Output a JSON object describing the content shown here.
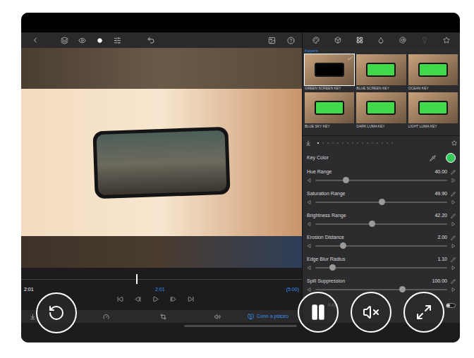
{
  "panel": {
    "section": "Keyers",
    "keyers": [
      {
        "label": "GREEN SCREEN KEY",
        "selected": true
      },
      {
        "label": "BLUE SCREEN KEY",
        "selected": false
      },
      {
        "label": "OCEAN KEY",
        "selected": false
      },
      {
        "label": "BLUE SKY KEY",
        "selected": false
      },
      {
        "label": "DARK LUMA KEY",
        "selected": false
      },
      {
        "label": "LIGHT LUMA KEY",
        "selected": false
      }
    ],
    "pages": [
      {
        "selected": true
      },
      {
        "selected": false
      },
      {
        "selected": false
      },
      {
        "selected": false
      },
      {
        "selected": false
      },
      {
        "selected": false
      },
      {
        "selected": false
      },
      {
        "selected": false
      },
      {
        "selected": false
      },
      {
        "selected": false
      },
      {
        "selected": false
      },
      {
        "selected": false
      },
      {
        "selected": false
      },
      {
        "selected": false
      },
      {
        "selected": false
      },
      {
        "selected": false
      }
    ],
    "key_color": {
      "label": "Key Color",
      "color": "#34c759"
    },
    "sliders": [
      {
        "label": "Hue Range",
        "value": "40.00",
        "level": 0.23
      },
      {
        "label": "Saturation Range",
        "value": "49.90",
        "level": 0.5
      },
      {
        "label": "Brightness Range",
        "value": "42.20",
        "level": 0.43
      },
      {
        "label": "Erosion Distance",
        "value": "2.00",
        "level": 0.21
      },
      {
        "label": "Edge Blur Radius",
        "value": "1.10",
        "level": 0.13
      },
      {
        "label": "Spill Suppression",
        "value": "100.00",
        "level": 0.66
      }
    ],
    "toggle": {
      "label": "Key",
      "on": false
    }
  },
  "timeline": {
    "current": "2:01",
    "playhead": "2:01",
    "duration": "(5:00)",
    "level": 0.41
  },
  "bottom_toolbar": {
    "link": "Conn a placeo"
  },
  "overlay": {
    "playing": true,
    "muted": true
  }
}
